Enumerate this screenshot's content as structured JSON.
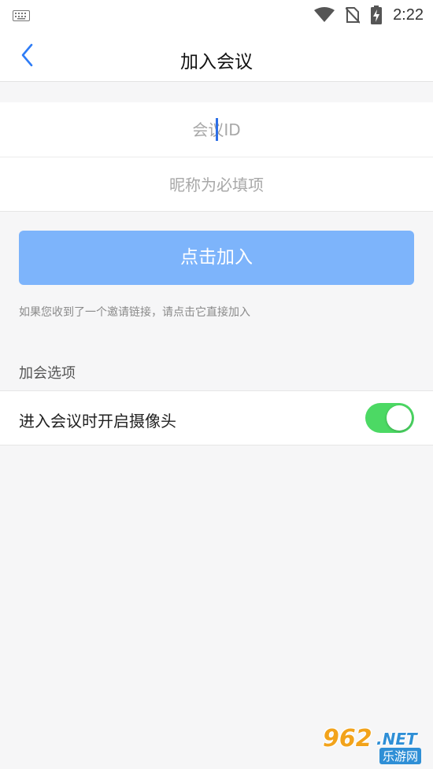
{
  "status_bar": {
    "time": "2:22",
    "icons": [
      "keyboard-icon",
      "wifi-icon",
      "no-sim-icon",
      "battery-charging-icon"
    ]
  },
  "header": {
    "title": "加入会议",
    "back_icon": "chevron-left-icon"
  },
  "form": {
    "meeting_id_placeholder": "会议ID",
    "meeting_id_value": "",
    "nickname_placeholder": "昵称为必填项",
    "nickname_value": ""
  },
  "join_button": {
    "label": "点击加入",
    "color": "#7db4fb"
  },
  "hint": "如果您收到了一个邀请链接，请点击它直接加入",
  "options": {
    "section_title": "加会选项",
    "camera_on_join": {
      "label": "进入会议时开启摄像头",
      "enabled": true,
      "color": "#4cd964"
    }
  },
  "watermark": {
    "number": "962",
    "suffix": ".NET",
    "sub": "乐游网"
  }
}
